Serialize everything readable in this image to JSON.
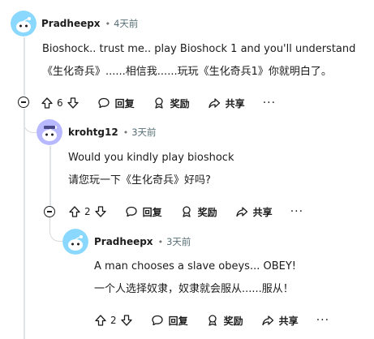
{
  "colors": {
    "avatar_bg": "#8bd8ff",
    "avatar_bg2": "#b7b8ff",
    "text": "#1c1c1c",
    "muted": "#576f76",
    "line": "#e0e3e5"
  },
  "comments": [
    {
      "author": "Pradheepx",
      "time": "4天前",
      "lines": [
        "Bioshock.. trust me.. play Bioshock 1 and you'll understand",
        "《生化奇兵》......相信我......玩玩《生化奇兵1》你就明白了。"
      ],
      "votes": "6",
      "reply_label": "回复",
      "award_label": "奖励",
      "share_label": "共享",
      "more": "···"
    },
    {
      "author": "krohtg12",
      "time": "3天前",
      "lines": [
        "Would you kindly play bioshock",
        "请您玩一下《生化奇兵》好吗?"
      ],
      "votes": "2",
      "reply_label": "回复",
      "award_label": "奖励",
      "share_label": "共享",
      "more": "···"
    },
    {
      "author": "Pradheepx",
      "time": "3天前",
      "lines": [
        "A man chooses a slave obeys... OBEY!",
        "一个人选择奴隶，奴隶就会服从......服从！"
      ],
      "votes": "2",
      "reply_label": "回复",
      "award_label": "奖励",
      "share_label": "共享",
      "more": "···"
    }
  ],
  "icons": [
    "upvote-icon",
    "downvote-icon",
    "reply-icon",
    "award-icon",
    "share-icon",
    "collapse-icon",
    "more-icon",
    "avatar"
  ]
}
